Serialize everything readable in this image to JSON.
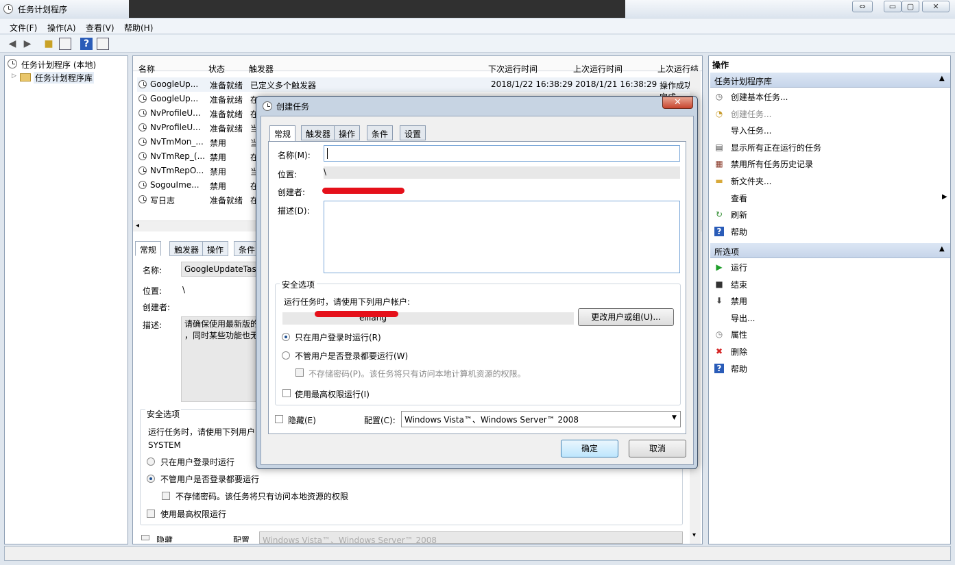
{
  "window": {
    "title": "任务计划程序",
    "restore_glyph": "⇔",
    "min_glyph": "▭",
    "max_glyph": "▢",
    "close_glyph": "✕"
  },
  "menu": [
    "文件(F)",
    "操作(A)",
    "查看(V)",
    "帮助(H)"
  ],
  "tree": {
    "root": "任务计划程序 (本地)",
    "child": "任务计划程序库"
  },
  "list": {
    "columns": [
      "名称",
      "状态",
      "触发器",
      "下次运行时间",
      "上次运行时间",
      "上次运行结"
    ],
    "rows": [
      {
        "name": "GoogleUp...",
        "status": "准备就绪",
        "trigger": "已定义多个触发器",
        "next": "2018/1/22 16:38:29",
        "last": "2018/1/21 16:38:29",
        "result": "操作成功完成"
      },
      {
        "name": "GoogleUp...",
        "status": "准备就绪",
        "trigger": "在"
      },
      {
        "name": "NvProfileU...",
        "status": "准备就绪",
        "trigger": "在"
      },
      {
        "name": "NvProfileU...",
        "status": "准备就绪",
        "trigger": "当"
      },
      {
        "name": "NvTmMon_...",
        "status": "禁用",
        "trigger": "当"
      },
      {
        "name": "NvTmRep_(...",
        "status": "禁用",
        "trigger": "在"
      },
      {
        "name": "NvTmRepO...",
        "status": "禁用",
        "trigger": "当"
      },
      {
        "name": "SogouIme...",
        "status": "禁用",
        "trigger": "在"
      },
      {
        "name": "写日志",
        "status": "准备就绪",
        "trigger": "在"
      }
    ]
  },
  "detail": {
    "tabs": [
      "常规",
      "触发器",
      "操作",
      "条件"
    ],
    "name_label": "名称:",
    "name_value": "GoogleUpdateTas",
    "location_label": "位置:",
    "location_value": "\\",
    "author_label": "创建者:",
    "desc_label": "描述:",
    "desc_value": "请确保使用最新版的\n，同时某些功能也无",
    "security_title": "安全选项",
    "run_as_text": "运行任务时，请使用下列用户",
    "account": "SYSTEM",
    "opt_logged_on": "只在用户登录时运行",
    "opt_whether": "不管用户是否登录都要运行",
    "opt_nopwd": "不存储密码。该任务将只有访问本地资源的权限",
    "opt_highest": "使用最高权限运行",
    "hidden_label": "隐藏",
    "config_label": "配置",
    "config_value": "Windows Vista™、Windows Server™ 2008"
  },
  "actions": {
    "header": "操作",
    "section1": "任务计划程序库",
    "items1": [
      {
        "label": "创建基本任务...",
        "icon": "clock-icon"
      },
      {
        "label": "创建任务...",
        "icon": "task-icon"
      },
      {
        "label": "导入任务...",
        "icon": ""
      },
      {
        "label": "显示所有正在运行的任务",
        "icon": "list-icon"
      },
      {
        "label": "禁用所有任务历史记录",
        "icon": "history-icon"
      },
      {
        "label": "新文件夹...",
        "icon": "folder-icon"
      },
      {
        "label": "查看",
        "icon": ""
      },
      {
        "label": "刷新",
        "icon": "refresh-icon"
      },
      {
        "label": "帮助",
        "icon": "help-icon"
      }
    ],
    "section2": "所选项",
    "items2": [
      {
        "label": "运行",
        "icon": "run-icon"
      },
      {
        "label": "结束",
        "icon": "stop-icon"
      },
      {
        "label": "禁用",
        "icon": "disable-icon"
      },
      {
        "label": "导出...",
        "icon": ""
      },
      {
        "label": "属性",
        "icon": "properties-icon"
      },
      {
        "label": "删除",
        "icon": "delete-icon"
      },
      {
        "label": "帮助",
        "icon": "help-icon"
      }
    ]
  },
  "dialog": {
    "title": "创建任务",
    "tabs": [
      "常规",
      "触发器",
      "操作",
      "条件",
      "设置"
    ],
    "name_label": "名称(M):",
    "name_value": "",
    "location_label": "位置:",
    "location_value": "\\",
    "author_label": "创建者:",
    "desc_label": "描述(D):",
    "security_title": "安全选项",
    "run_as_text": "运行任务时，请使用下列用户帐户:",
    "account_suffix": "eiliang",
    "change_user_btn": "更改用户或组(U)...",
    "opt_logged_on": "只在用户登录时运行(R)",
    "opt_whether": "不管用户是否登录都要运行(W)",
    "opt_nopwd": "不存储密码(P)。该任务将只有访问本地计算机资源的权限。",
    "opt_highest": "使用最高权限运行(I)",
    "hidden_label": "隐藏(E)",
    "config_label": "配置(C):",
    "config_value": "Windows Vista™、Windows Server™ 2008",
    "ok": "确定",
    "cancel": "取消"
  }
}
